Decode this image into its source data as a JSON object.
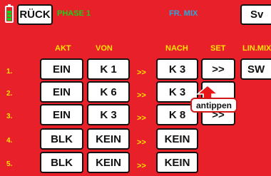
{
  "header": {
    "back_label": "RÜCK",
    "phase_label": "PHASE 1",
    "title": "FR. MIX",
    "sv_label": "Sv",
    "battery_icon": "battery-icon",
    "colors": {
      "background": "#e8202a",
      "accent_green": "#18d018",
      "accent_yellow": "#ffe400",
      "title_blue": "#2aa9e0"
    }
  },
  "columns": {
    "akt": "AKT",
    "von": "VON",
    "nach": "NACH",
    "set": "SET",
    "linmix": "LIN.MIX"
  },
  "rows": [
    {
      "num": "1.",
      "akt": "EIN",
      "von": "K 1",
      "arrow": ">>",
      "nach": "K 3",
      "set": ">>",
      "lin": "SW"
    },
    {
      "num": "2.",
      "akt": "EIN",
      "von": "K 6",
      "arrow": ">>",
      "nach": "K 3",
      "set": ""
    },
    {
      "num": "3.",
      "akt": "EIN",
      "von": "K 3",
      "arrow": ">>",
      "nach": "K 8",
      "set": ">>"
    },
    {
      "num": "4.",
      "akt": "BLK",
      "von": "KEIN",
      "arrow": ">>",
      "nach": "KEIN"
    },
    {
      "num": "5.",
      "akt": "BLK",
      "von": "KEIN",
      "arrow": ">>",
      "nach": "KEIN"
    }
  ],
  "annotation": {
    "label": "antippen",
    "icon": "arrow-up-icon"
  }
}
